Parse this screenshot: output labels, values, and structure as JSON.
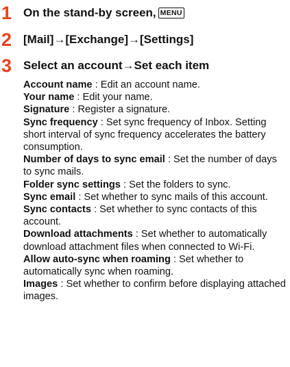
{
  "steps": [
    {
      "num": "1",
      "text": "On the stand-by screen,",
      "key": "MENU"
    },
    {
      "num": "2",
      "text": "[Mail]→[Exchange]→[Settings]"
    },
    {
      "num": "3",
      "text": "Select an account→Set each item"
    }
  ],
  "items": [
    {
      "term": "Account name",
      "desc": " : Edit an account name."
    },
    {
      "term": "Your name",
      "desc": " : Edit your name."
    },
    {
      "term": "Signature",
      "desc": " : Register a signature."
    },
    {
      "term": "Sync frequency",
      "desc": " : Set sync frequency of Inbox. Setting short interval of sync frequency accelerates the battery consumption."
    },
    {
      "term": "Number of days to sync email",
      "desc": " : Set the number of days to sync mails."
    },
    {
      "term": "Folder sync settings",
      "desc": " : Set the folders to sync."
    },
    {
      "term": "Sync email",
      "desc": " : Set whether to sync mails of this account."
    },
    {
      "term": "Sync contacts",
      "desc": " : Set whether to sync contacts of this account."
    },
    {
      "term": "Download attachments",
      "desc": " : Set whether to automatically download attachment files when connected to Wi-Fi."
    },
    {
      "term": "Allow auto-sync when roaming",
      "desc": " : Set whether to automatically sync when roaming."
    },
    {
      "term": "Images",
      "desc": " : Set whether to confirm before displaying attached images."
    }
  ]
}
